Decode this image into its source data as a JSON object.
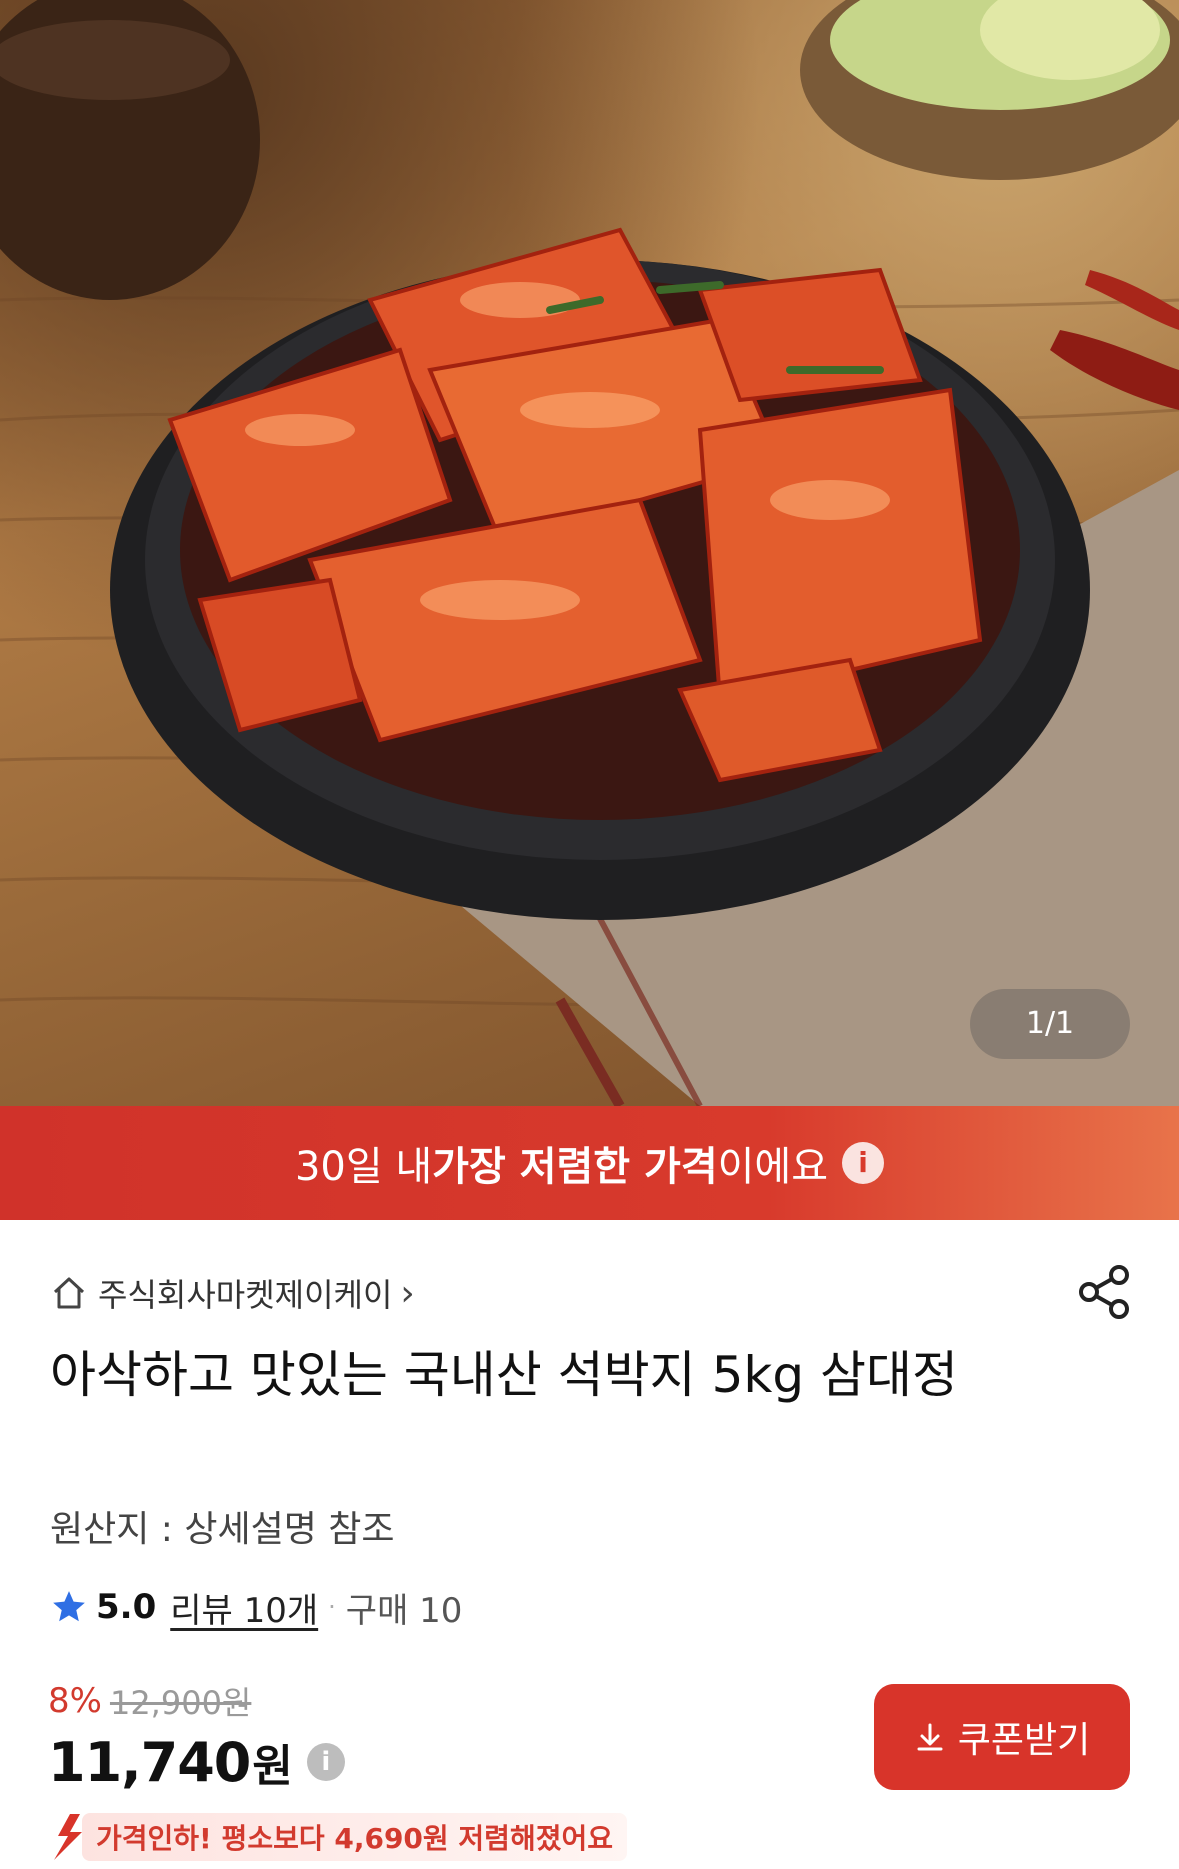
{
  "gallery": {
    "counter": "1/1"
  },
  "banner": {
    "text_pre": "30일 내 ",
    "text_strong1": "가장 저렴한 가격",
    "text_post": "이에요",
    "info_icon": "i"
  },
  "seller": {
    "name": "주식회사마켓제이케이",
    "chevron": "›"
  },
  "product": {
    "title": "아삭하고 맛있는 국내산 석박지 5kg 삼대정",
    "origin": "원산지 : 상세설명 참조"
  },
  "rating": {
    "score": "5.0",
    "reviews": "리뷰 10개",
    "separator": "·",
    "purchases": "구매 10"
  },
  "price": {
    "discount": "8%",
    "original": "12,900원",
    "current": "11,740",
    "currency": "원",
    "info_icon": "i"
  },
  "coupon_button": {
    "label": "쿠폰받기"
  },
  "price_drop": {
    "text": "가격인하! 평소보다 4,690원 저렴해졌어요"
  },
  "colors": {
    "accent": "#d8342a",
    "banner_end": "#e8734a",
    "star": "#2f6fe4"
  }
}
